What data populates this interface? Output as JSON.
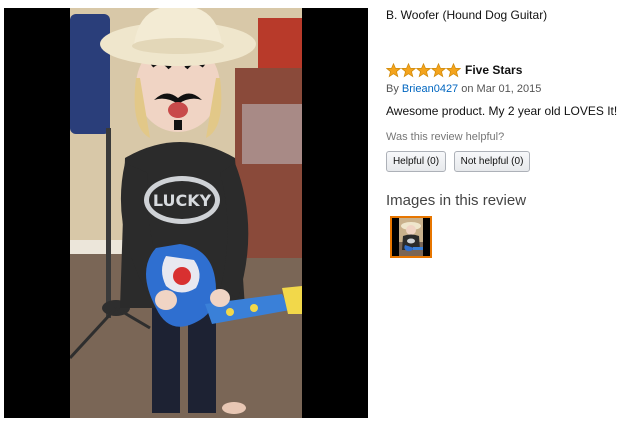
{
  "product": {
    "title": "B. Woofer (Hound Dog Guitar)"
  },
  "review": {
    "rating": 5,
    "rating_max": 5,
    "star_color": "#f4a41d",
    "title": "Five Stars",
    "by_prefix": "By ",
    "author": "Briean0427",
    "date_text": " on Mar 01, 2015",
    "body": "Awesome product. My 2 year old LOVES It!",
    "helpful_question": "Was this review helpful?",
    "helpful_button": "Helpful (0)",
    "not_helpful_button": "Not helpful (0)",
    "author_link_color": "#0066c0"
  },
  "images_section": {
    "heading": "Images in this review",
    "thumbnail_selected_color": "#e77600",
    "thumbnail_count": 1
  },
  "photo": {
    "description_icon": "photo-child-with-toy-guitar",
    "shirt_text": "LUCKY"
  }
}
